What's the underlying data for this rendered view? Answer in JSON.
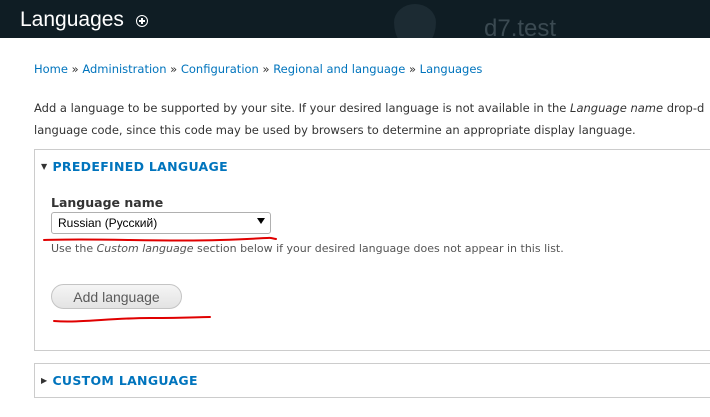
{
  "header": {
    "title": "Languages",
    "shortcut_icon": "plus-circle-icon",
    "site_name": "d7.test"
  },
  "breadcrumb": {
    "items": [
      "Home",
      "Administration",
      "Configuration",
      "Regional and language",
      "Languages"
    ],
    "separator": "»"
  },
  "help": {
    "part1": "Add a language to be supported by your site. If your desired language is not available in the ",
    "em1": "Language name",
    "part2": " drop-d",
    "line2": "language code, since this code may be used by browsers to determine an appropriate display language."
  },
  "predefined": {
    "legend": "Predefined language",
    "field_label": "Language name",
    "selected": "Russian (Русский)",
    "description_pre": "Use the ",
    "description_em": "Custom language",
    "description_post": " section below if your desired language does not appear in this list.",
    "button": "Add language"
  },
  "custom": {
    "legend": "Custom language"
  },
  "colors": {
    "header_bg": "#0f1d24",
    "link": "#0074bd",
    "annotation": "#e00000"
  }
}
